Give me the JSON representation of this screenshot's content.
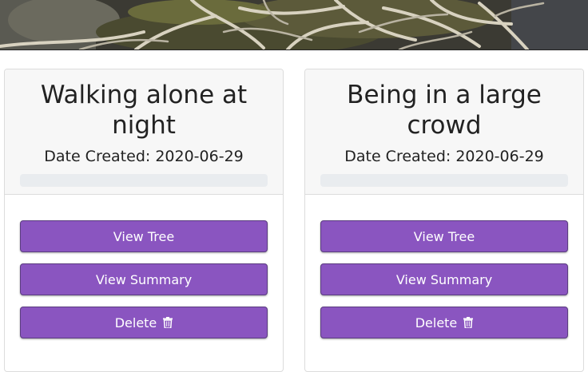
{
  "cards": [
    {
      "title": "Walking alone at night",
      "date": "Date Created: 2020-06-29",
      "buttons": {
        "view_tree": "View Tree",
        "view_summary": "View Summary",
        "delete": "Delete"
      }
    },
    {
      "title": "Being in a large crowd",
      "date": "Date Created: 2020-06-29",
      "buttons": {
        "view_tree": "View Tree",
        "view_summary": "View Summary",
        "delete": "Delete"
      }
    }
  ],
  "colors": {
    "button": "#8a55c0",
    "header_bg": "#f7f7f7",
    "progress_track": "#e9ecef"
  },
  "icons": {
    "delete": "trash-icon"
  }
}
